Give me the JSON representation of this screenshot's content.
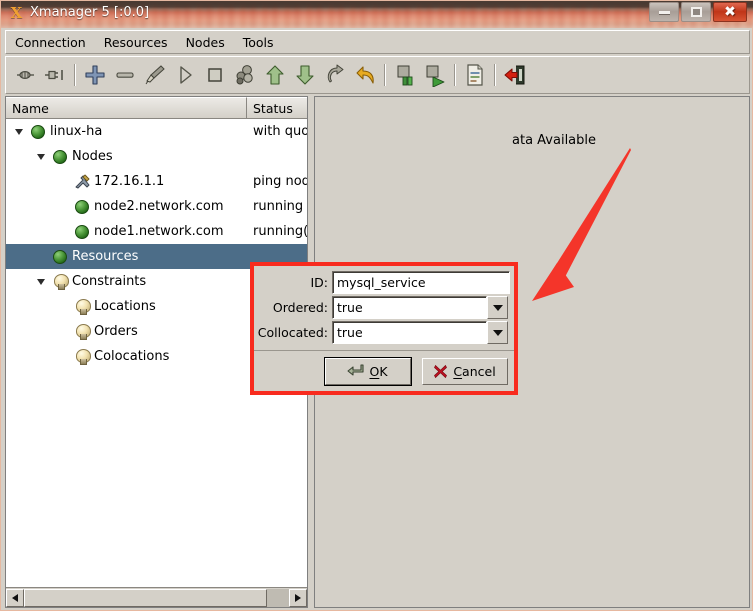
{
  "window": {
    "title": "Xmanager 5 [:0.0]",
    "app_icon": "X",
    "controls": {
      "minimize": "minimize-icon",
      "maximize": "maximize-icon",
      "close": "✖"
    }
  },
  "menubar": {
    "items": [
      {
        "label": "Connection"
      },
      {
        "label": "Resources"
      },
      {
        "label": "Nodes"
      },
      {
        "label": "Tools"
      }
    ]
  },
  "toolbar": {
    "buttons": [
      {
        "name": "connect-icon",
        "title": "Connect"
      },
      {
        "name": "disconnect-icon",
        "title": "Disconnect"
      },
      {
        "sep": true
      },
      {
        "name": "add-icon",
        "title": "Add"
      },
      {
        "name": "remove-icon",
        "title": "Remove"
      },
      {
        "name": "cleanup-brush-icon",
        "title": "Cleanup"
      },
      {
        "name": "start-play-icon",
        "title": "Start"
      },
      {
        "name": "stop-square-icon",
        "title": "Stop"
      },
      {
        "name": "migrate-group-icon",
        "title": "Migrate"
      },
      {
        "name": "move-up-icon",
        "title": "Move Up"
      },
      {
        "name": "move-down-icon",
        "title": "Move Down"
      },
      {
        "name": "refresh-icon",
        "title": "Refresh"
      },
      {
        "name": "undo-icon",
        "title": "Undo"
      },
      {
        "sep": true
      },
      {
        "name": "standby-node-icon",
        "title": "Standby"
      },
      {
        "name": "online-node-icon",
        "title": "Online"
      },
      {
        "sep": true
      },
      {
        "name": "report-icon",
        "title": "Report"
      },
      {
        "sep": true
      },
      {
        "name": "exit-icon",
        "title": "Exit"
      }
    ]
  },
  "tree": {
    "columns": [
      {
        "label": "Name"
      },
      {
        "label": "Status"
      }
    ],
    "rows": [
      {
        "indent": 0,
        "twisty": "expanded",
        "icon": "green-ball-icon",
        "label": "linux-ha",
        "status": "with quor",
        "selected": false
      },
      {
        "indent": 1,
        "twisty": "expanded",
        "icon": "green-ball-icon",
        "label": "Nodes",
        "status": "",
        "selected": false
      },
      {
        "indent": 2,
        "twisty": "none",
        "icon": "tools-icon",
        "label": "172.16.1.1",
        "status": "ping node",
        "selected": false
      },
      {
        "indent": 2,
        "twisty": "none",
        "icon": "green-ball-icon",
        "label": "node2.network.com",
        "status": "running",
        "selected": false
      },
      {
        "indent": 2,
        "twisty": "none",
        "icon": "green-ball-icon",
        "label": "node1.network.com",
        "status": "running(c",
        "selected": false
      },
      {
        "indent": 1,
        "twisty": "none",
        "icon": "green-ball-icon",
        "label": "Resources",
        "status": "",
        "selected": true
      },
      {
        "indent": 1,
        "twisty": "expanded",
        "icon": "bulb-icon",
        "label": "Constraints",
        "status": "",
        "selected": false
      },
      {
        "indent": 2,
        "twisty": "none",
        "icon": "bulb-icon",
        "label": "Locations",
        "status": "",
        "selected": false
      },
      {
        "indent": 2,
        "twisty": "none",
        "icon": "bulb-icon",
        "label": "Orders",
        "status": "",
        "selected": false
      },
      {
        "indent": 2,
        "twisty": "none",
        "icon": "bulb-icon",
        "label": "Colocations",
        "status": "",
        "selected": false
      }
    ]
  },
  "detail": {
    "message": "ata Available"
  },
  "dialog": {
    "fields": [
      {
        "label": "ID:",
        "value": "mysql_service",
        "type": "text"
      },
      {
        "label": "Ordered:",
        "value": "true",
        "type": "combo"
      },
      {
        "label": "Collocated:",
        "value": "true",
        "type": "combo"
      }
    ],
    "buttons": {
      "ok": {
        "label": "OK",
        "mnemonic": "O",
        "icon": "enter-arrow-icon"
      },
      "cancel": {
        "label": "Cancel",
        "mnemonic": "C",
        "icon": "red-x-icon"
      }
    }
  },
  "annotation": {
    "arrow_color": "#f4352a",
    "highlight_color": "#f82b1e"
  }
}
